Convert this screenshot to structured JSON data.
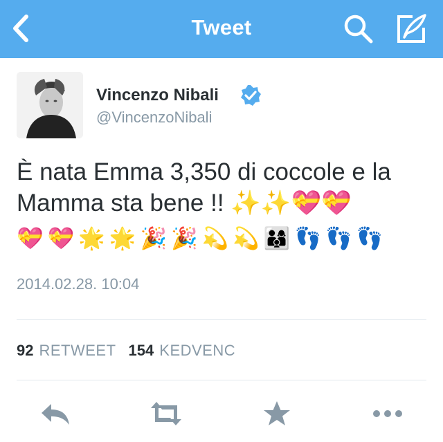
{
  "navbar": {
    "title": "Tweet",
    "back_icon": "back-chevron-icon",
    "search_icon": "search-icon",
    "compose_icon": "compose-icon",
    "background": "#55acee"
  },
  "author": {
    "name": "Vincenzo Nibali",
    "handle": "@VincenzoNibali",
    "verified": true,
    "verified_color": "#55acee"
  },
  "tweet": {
    "text": "È nata Emma 3,350 di coccole e la Mamma sta bene !! ✨✨💝💝",
    "emoji_row": [
      "💝",
      "💝",
      "🌟",
      "🌟",
      "🎉",
      "🎉",
      "💫",
      "💫",
      "👨‍👩‍👦",
      "👣",
      "👣",
      "👣"
    ]
  },
  "timestamp": "2014.02.28. 10:04",
  "stats": {
    "retweets": "92",
    "retweets_label": "RETWEET",
    "favorites": "154",
    "favorites_label": "KEDVENC"
  },
  "actions": {
    "reply_icon": "reply-icon",
    "retweet_icon": "retweet-icon",
    "favorite_icon": "star-icon",
    "more_icon": "more-icon",
    "color": "#8899a6"
  }
}
